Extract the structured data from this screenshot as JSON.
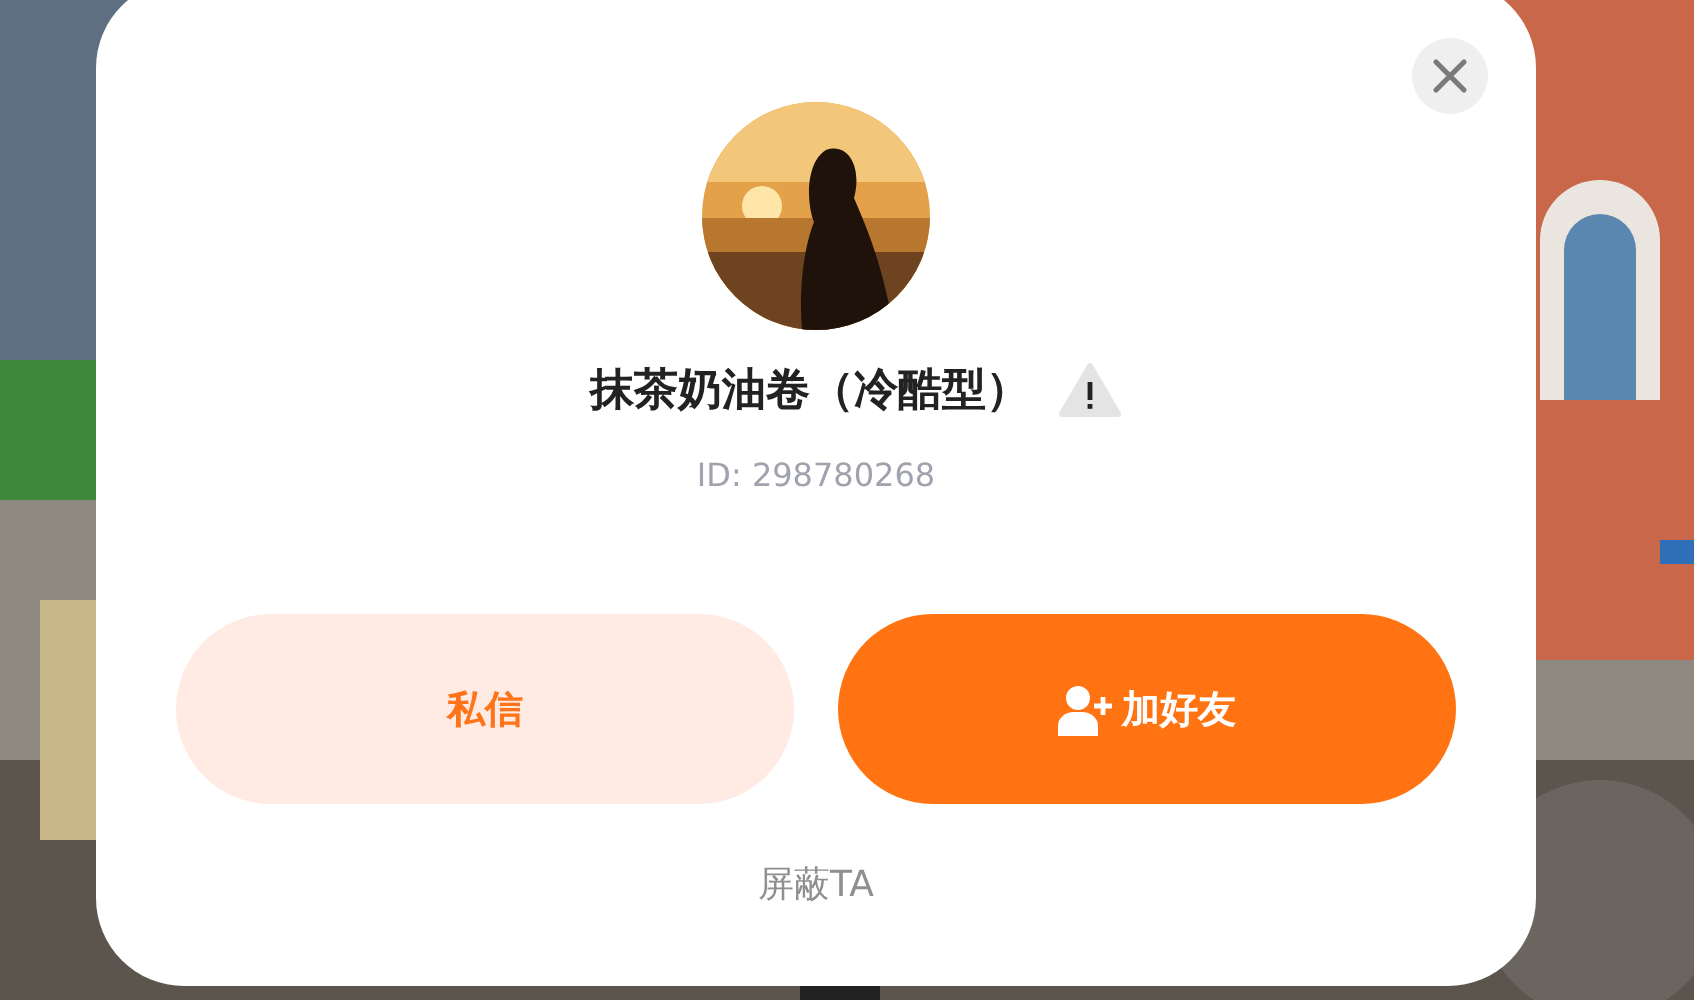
{
  "profile": {
    "nickname": "抹茶奶油卷（冷酷型）",
    "user_id": "ID: 298780268"
  },
  "actions": [
    {
      "label": "私信",
      "kind": "secondary"
    },
    {
      "label": "加好友",
      "kind": "primary"
    }
  ],
  "block_link": "屏蔽TA"
}
